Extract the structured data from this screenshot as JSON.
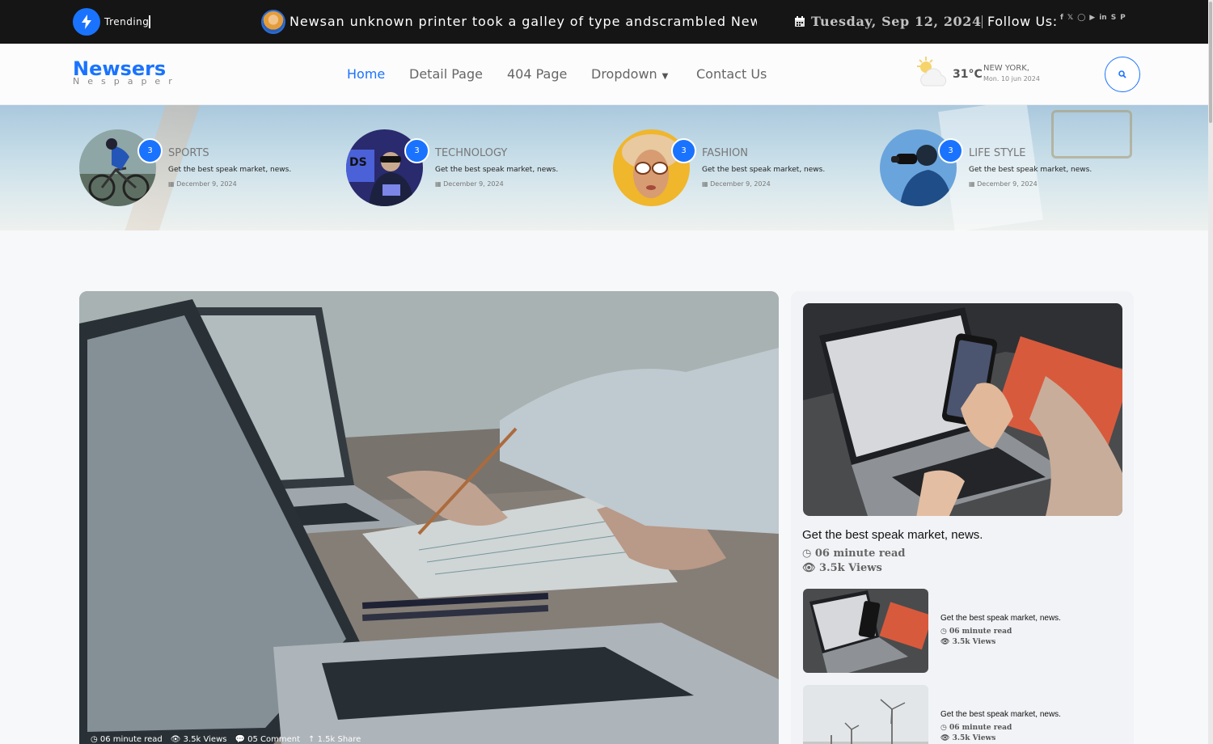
{
  "topbar": {
    "trending_label": "Trending",
    "ticker_text": "Newsan unknown printer took a galley of type andscrambled Newsa",
    "date": "Tuesday, Sep 12, 2024",
    "follow_label": "Follow Us:",
    "socials": [
      "facebook-icon",
      "twitter-icon",
      "instagram-icon",
      "youtube-icon",
      "linkedin-icon",
      "skype-icon",
      "pinterest-icon"
    ]
  },
  "nav": {
    "brand": "Newsers",
    "brand_sub": "Nespaper",
    "items": [
      "Home",
      "Detail Page",
      "404 Page",
      "Dropdown",
      "Contact Us"
    ],
    "active": "Home"
  },
  "weather": {
    "temp": "31°C",
    "city": "NEW YORK,",
    "date": "Mon. 10 jun 2024"
  },
  "categories": [
    {
      "name": "SPORTS",
      "count": "3",
      "title": "Get the best speak market, news.",
      "date": "December 9, 2024"
    },
    {
      "name": "TECHNOLOGY",
      "count": "3",
      "title": "Get the best speak market, news.",
      "date": "December 9, 2024"
    },
    {
      "name": "FASHION",
      "count": "3",
      "title": "Get the best speak market, news.",
      "date": "December 9, 2024"
    },
    {
      "name": "LIFE STYLE",
      "count": "3",
      "title": "Get the best speak market, news.",
      "date": "December 9, 2024"
    }
  ],
  "hero": {
    "read": "06 minute read",
    "views": "3.5k Views",
    "comments": "05 Comment",
    "share": "1.5k Share"
  },
  "sidebar": {
    "featured": {
      "title": "Get the best speak market, news.",
      "read": "06 minute read",
      "views": "3.5k Views"
    },
    "items": [
      {
        "title": "Get the best speak market, news.",
        "read": "06 minute read",
        "views": "3.5k Views"
      },
      {
        "title": "Get the best speak market, news.",
        "read": "06 minute read",
        "views": "3.5k Views"
      }
    ]
  },
  "colors": {
    "accent": "#1a73ff",
    "topbar": "#151515"
  }
}
